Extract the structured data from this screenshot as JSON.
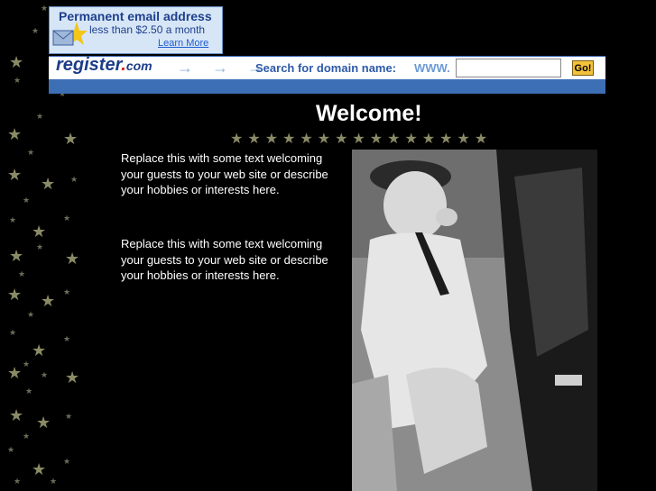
{
  "ad": {
    "title": "Permanent email address",
    "subtitle": "less than $2.50 a month",
    "link": "Learn More"
  },
  "register_bar": {
    "logo_main": "register",
    "logo_dot": ".",
    "logo_com": "com",
    "arrows": "→ → →",
    "search_label": "Search for domain name:",
    "www_label": "WWW.",
    "input_value": "",
    "go_label": "Go!"
  },
  "main": {
    "heading": "Welcome!",
    "paragraph_1": "Replace this with some text welcoming your guests to your web site or describe your hobbies or interests here.",
    "paragraph_2": "Replace this with some text welcoming your guests to your web site or describe your hobbies or interests here.",
    "star_divider_count": 15
  },
  "colors": {
    "background": "#000000",
    "ad_background": "#d6e6f6",
    "brand_blue": "#1d3d88",
    "strip_blue": "#3d6fb5",
    "go_button": "#f2c23c"
  }
}
